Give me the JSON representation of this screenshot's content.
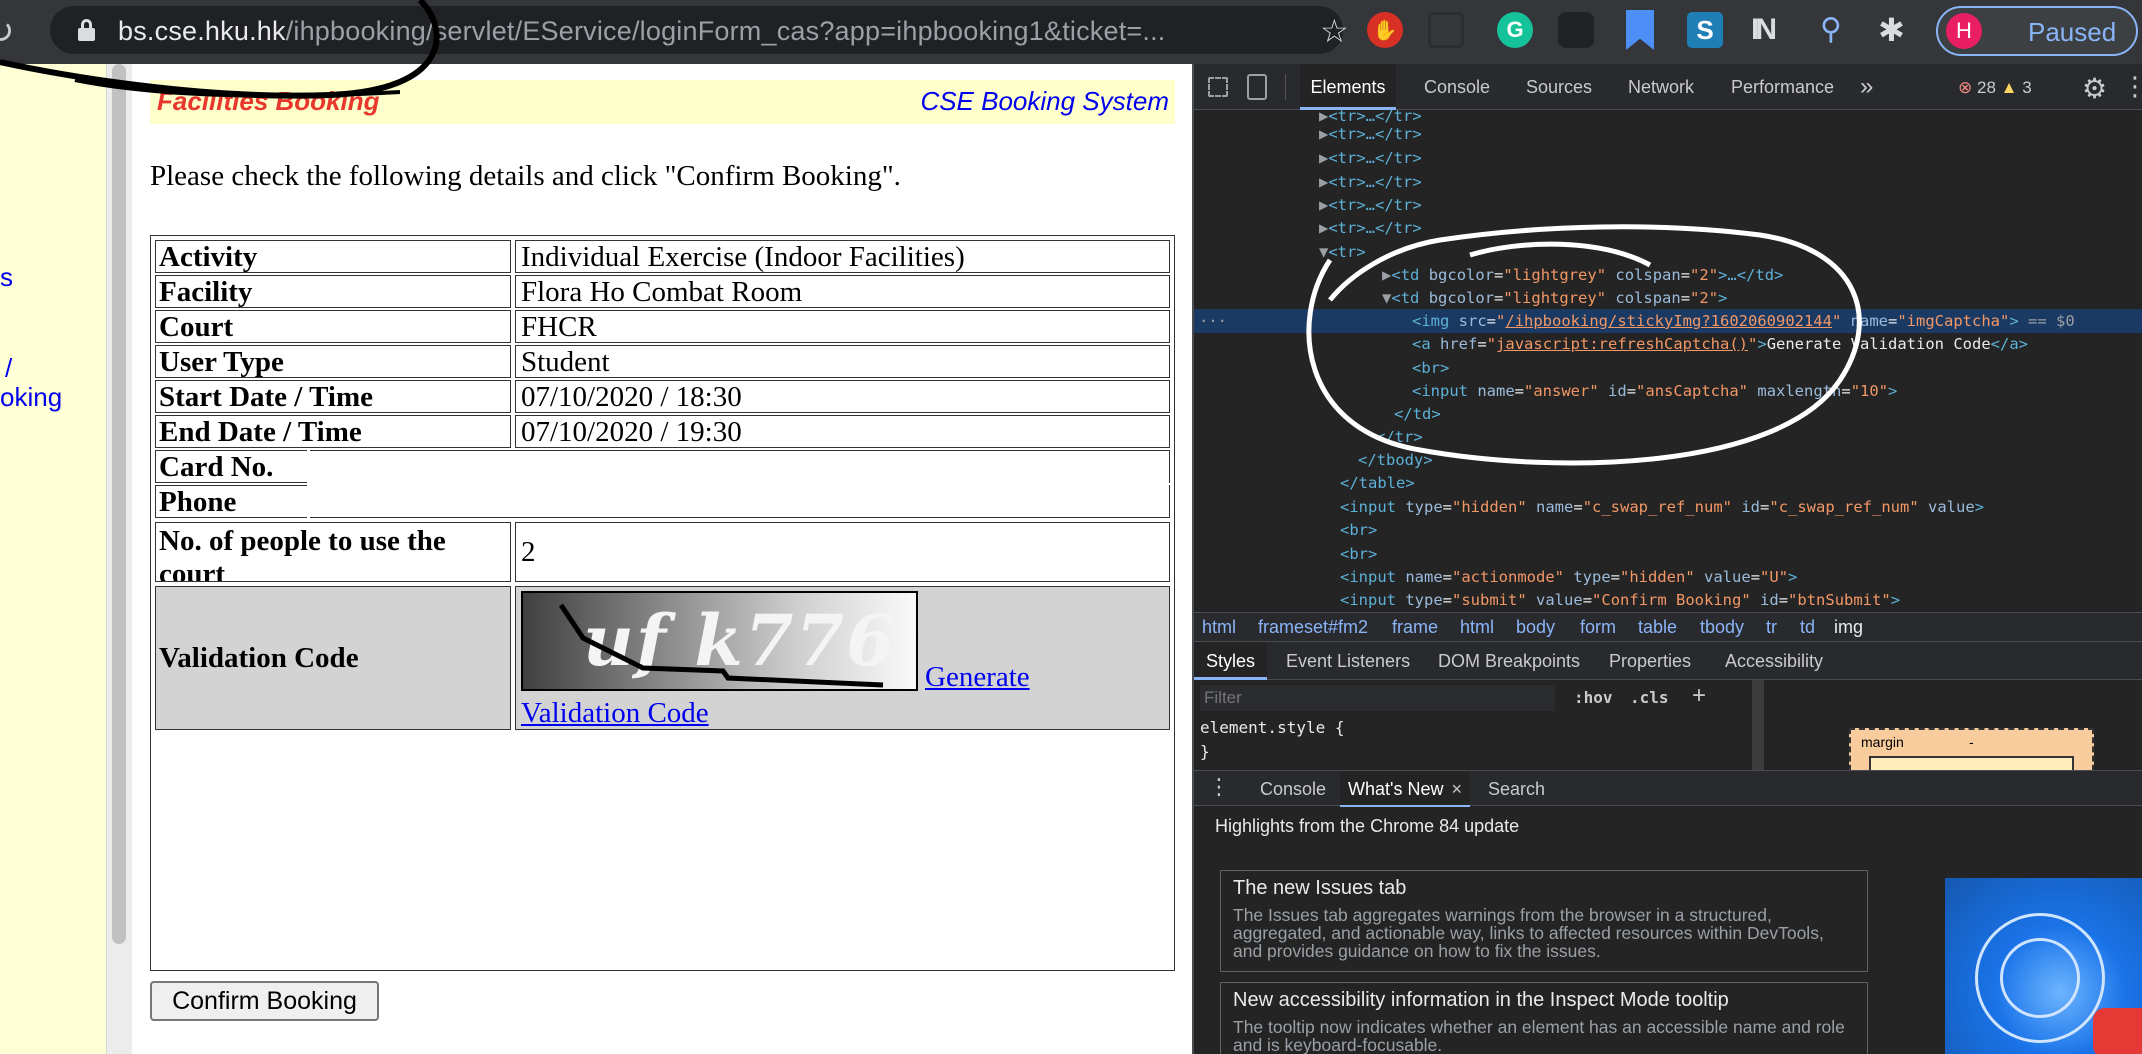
{
  "browser": {
    "url_host": "bs.cse.hku.hk",
    "url_path": "/ihpbooking/servlet/EService/loginForm_cas?app=ihpbooking1&ticket=...",
    "profile_initial": "H",
    "profile_status": "Paused",
    "colors": {
      "toolbar": "#35363a",
      "omnibox": "#202124",
      "profile_ring": "#8ab4f8",
      "avatar": "#e91e63"
    }
  },
  "left_frame": {
    "link_fragments": [
      "s",
      "/",
      "oking"
    ],
    "background": "#ffffd6"
  },
  "page": {
    "header_left": "Facilities Booking",
    "header_right": "CSE Booking System",
    "instruction": "Please check the following details and click \"Confirm Booking\".",
    "rows": [
      {
        "label": "Activity",
        "value": "Individual Exercise (Indoor Facilities)"
      },
      {
        "label": "Facility",
        "value": "Flora Ho Combat Room"
      },
      {
        "label": "Court",
        "value": "FHCR"
      },
      {
        "label": "User Type",
        "value": "Student"
      },
      {
        "label": "Start Date / Time",
        "value": "07/10/2020 / 18:30"
      },
      {
        "label": "End Date / Time",
        "value": "07/10/2020 / 19:30"
      },
      {
        "label": "Card No.",
        "value": ""
      },
      {
        "label": "Phone",
        "value": ""
      },
      {
        "label": "No. of people to use the court",
        "value": "2"
      }
    ],
    "validation": {
      "label": "Validation Code",
      "captcha_text": "uf k776",
      "link_part1": "Generate",
      "link_part2": "Validation Code",
      "answer_value": ""
    },
    "confirm_button": "Confirm Booking"
  },
  "devtools": {
    "tabs": [
      "Elements",
      "Console",
      "Sources",
      "Network",
      "Performance",
      "»"
    ],
    "active_tab": "Elements",
    "errors": "28",
    "warnings": "3",
    "dom_lines": {
      "tr1": "<tr>…</tr>",
      "tr_open": "<tr>",
      "td1_tag": "td",
      "td_attr_bg": "bgcolor",
      "td_attr_bg_val": "\"lightgrey\"",
      "td_attr_colspan": "colspan",
      "td_attr_colspan_val": "\"2\"",
      "td1_tail": ">…</td>",
      "img_src": "/ihpbooking/stickyImg?1602060902144",
      "img_name": "\"imgCaptcha\"",
      "selected_marker": "== $0",
      "a_href": "javascript:refreshCaptcha()",
      "a_text": "Generate Validation Code",
      "br": "<br>",
      "input_name": "\"answer\"",
      "input_id": "\"ansCaptcha\"",
      "input_maxlength": "\"10\"",
      "td_close": "</td>",
      "tr_close": "</tr>",
      "tbody_close": "</tbody>",
      "table_close": "</table>",
      "hidden_input_name": "\"c_swap_ref_num\"",
      "hidden_input_id": "\"c_swap_ref_num\"",
      "action_name": "\"actionmode\"",
      "action_value": "\"U\"",
      "submit_value": "\"Confirm Booking\"",
      "submit_id": "\"btnSubmit\""
    },
    "breadcrumbs": [
      "html",
      "frameset#fm2",
      "frame",
      "html",
      "body",
      "form",
      "table",
      "tbody",
      "tr",
      "td",
      "img"
    ],
    "style_tabs": [
      "Styles",
      "Event Listeners",
      "DOM Breakpoints",
      "Properties",
      "Accessibility"
    ],
    "filter_placeholder": "Filter",
    "hov_label": ":hov",
    "cls_label": ".cls",
    "plus_label": "+",
    "element_style": "element.style {",
    "element_style_close": "}",
    "box_model_label": "margin",
    "box_model_value": "-",
    "drawer_tabs": [
      "Console",
      "What's New",
      "Search"
    ],
    "drawer_close": "×",
    "whats_new_heading": "Highlights from the Chrome 84 update",
    "cards": [
      {
        "title": "The new Issues tab",
        "desc": "The Issues tab aggregates warnings from the browser in a structured, aggregated, and actionable way, links to affected resources within DevTools, and provides guidance on how to fix the issues."
      },
      {
        "title": "New accessibility information in the Inspect Mode tooltip",
        "desc": "The tooltip now indicates whether an element has an accessible name and role and is keyboard-focusable."
      }
    ]
  }
}
